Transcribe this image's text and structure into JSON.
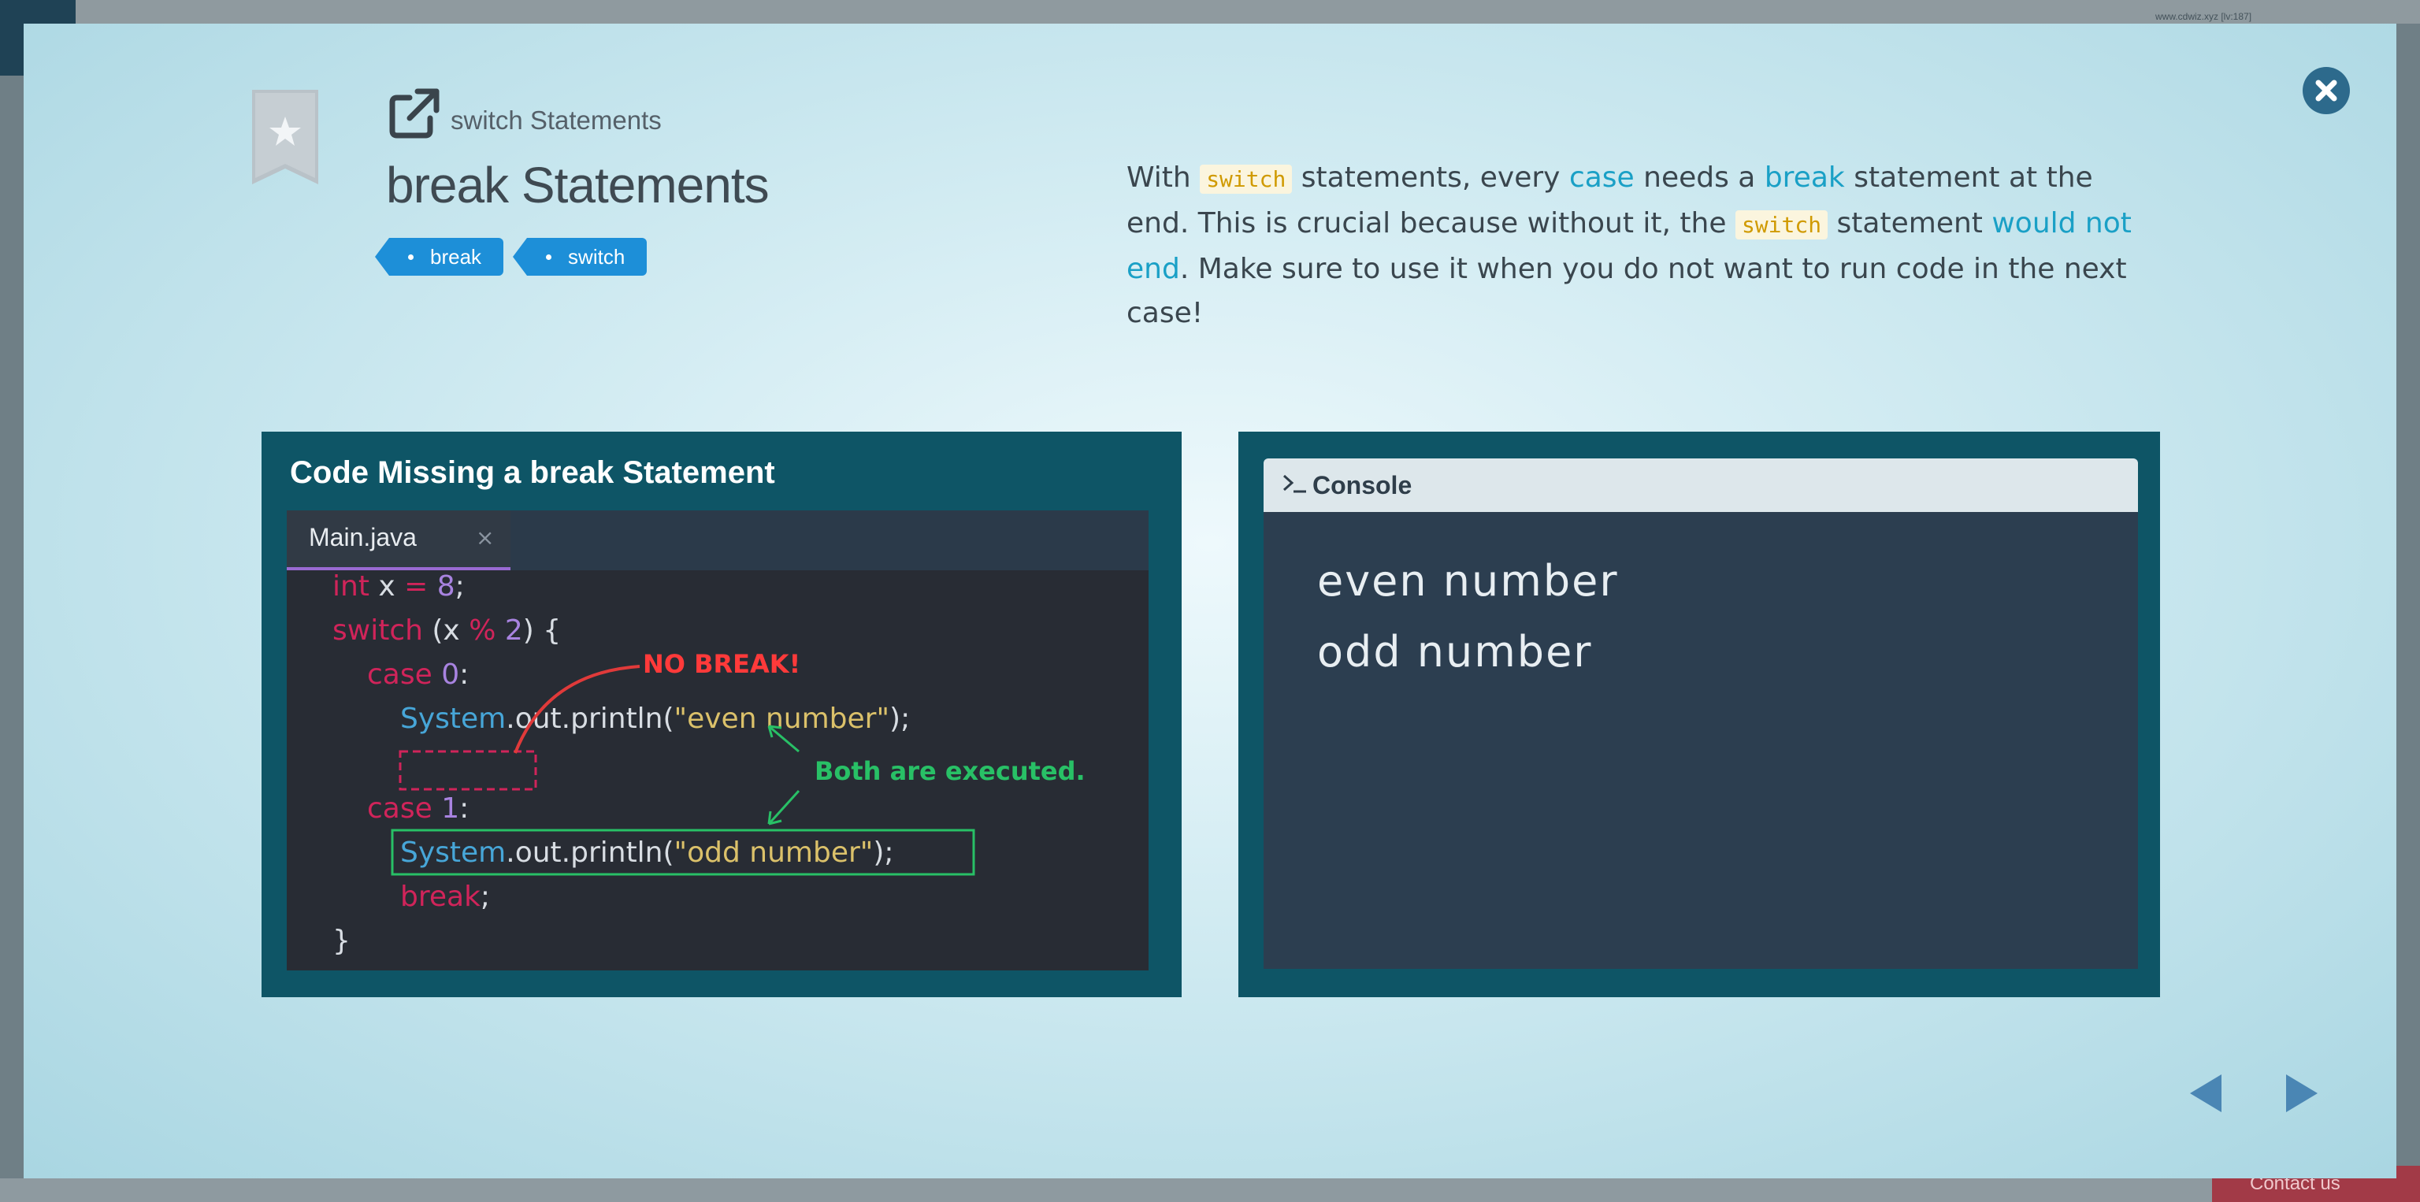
{
  "background": {
    "url_text": "www.cdwiz.xyz [lv:187]",
    "contact_label": "Contact us"
  },
  "modal": {
    "parent_link": "switch Statements",
    "title": "break Statements",
    "tags": [
      "break",
      "switch"
    ],
    "description": {
      "p1": "With ",
      "code1": "switch",
      "p2": " statements, every ",
      "kw1": "case",
      "p3": " needs a ",
      "kw2": "break",
      "p4": " statement at the end. This is crucial because without it, the ",
      "code2": "switch",
      "p5": " statement ",
      "kw3": "would not end",
      "p6": ". Make sure to use it when you do not want to run code in the next case!"
    },
    "code_panel": {
      "title": "Code Missing a break Statement",
      "file_tab": "Main.java",
      "file_tab_close": "×",
      "lines": {
        "l1_kw": "int",
        "l1_a": " x ",
        "l1_op": "=",
        "l1_num": " 8",
        "l1_end": ";",
        "l2_kw": "switch",
        "l2_a": " (x ",
        "l2_op": "%",
        "l2_num": " 2",
        "l2_end": ") {",
        "l3_kw": "case",
        "l3_num": " 0",
        "l3_end": ":",
        "l4_sys": "System",
        "l4_a": ".out.println(",
        "l4_str": "\"even number\"",
        "l4_end": ");",
        "l5_kw": "case",
        "l5_num": " 1",
        "l5_end": ":",
        "l6_sys": "System",
        "l6_a": ".out.println(",
        "l6_str": "\"odd number\"",
        "l6_end": ");",
        "l7_kw": "break",
        "l7_end": ";",
        "l8": "}"
      },
      "annotation_red": "NO BREAK!",
      "annotation_green": "Both are executed."
    },
    "console": {
      "header": "Console",
      "output": [
        "even number",
        "odd number"
      ]
    },
    "colors": {
      "panel_bg": "#0e5566",
      "tag_bg": "#1d8fd8",
      "keyword_link": "#1aa0c6",
      "close_button": "#2d6a8c"
    },
    "icons": {
      "bookmark": "star-bookmark-icon",
      "external": "external-link-icon",
      "close": "close-icon",
      "prompt": "terminal-prompt-icon",
      "prev": "prev-arrow-icon",
      "next": "next-arrow-icon"
    }
  }
}
